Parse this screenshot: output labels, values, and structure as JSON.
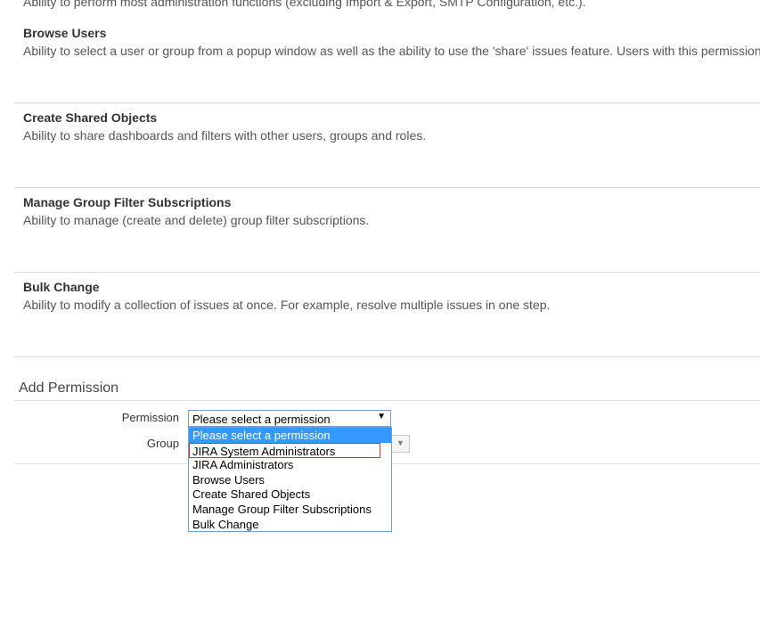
{
  "clipped_previous": {
    "description": "Ability to perform most administration functions (excluding Import & Export, SMTP Configuration, etc.)."
  },
  "permissions": [
    {
      "title": "Browse Users",
      "description": "Ability to select a user or group from a popup window as well as the ability to use the 'share' issues feature. Users with this permission"
    },
    {
      "title": "Create Shared Objects",
      "description": "Ability to share dashboards and filters with other users, groups and roles."
    },
    {
      "title": "Manage Group Filter Subscriptions",
      "description": "Ability to manage (create and delete) group filter subscriptions."
    },
    {
      "title": "Bulk Change",
      "description": "Ability to modify a collection of issues at once. For example, resolve multiple issues in one step."
    }
  ],
  "add_permission": {
    "heading": "Add Permission",
    "permission_label": "Permission",
    "group_label": "Group",
    "selected_value": "Please select a permission",
    "options": [
      "Please select a permission",
      "JIRA System Administrators",
      "JIRA Administrators",
      "Browse Users",
      "Create Shared Objects",
      "Manage Group Filter Subscriptions",
      "Bulk Change"
    ],
    "highlight_color": "#3399ff"
  }
}
